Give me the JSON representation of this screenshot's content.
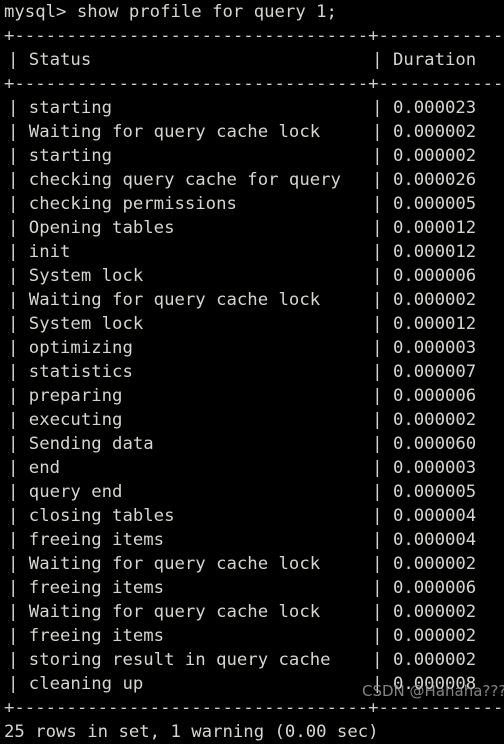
{
  "terminal": {
    "prompt_line": "mysql> show profile for query 1;",
    "separator_char": "+",
    "dash_char": "-",
    "pipe_char": "|",
    "bg_color": "#000000",
    "fg_color": "#d3d7cf",
    "columns": [
      {
        "name": "Status",
        "header": "Status",
        "width": 32,
        "align": "left"
      },
      {
        "name": "Duration",
        "header": "Duration",
        "width": 10,
        "align": "left"
      }
    ],
    "rows": [
      {
        "status": "starting",
        "duration": "0.000023"
      },
      {
        "status": "Waiting for query cache lock",
        "duration": "0.000002"
      },
      {
        "status": "starting",
        "duration": "0.000002"
      },
      {
        "status": "checking query cache for query",
        "duration": "0.000026"
      },
      {
        "status": "checking permissions",
        "duration": "0.000005"
      },
      {
        "status": "Opening tables",
        "duration": "0.000012"
      },
      {
        "status": "init",
        "duration": "0.000012"
      },
      {
        "status": "System lock",
        "duration": "0.000006"
      },
      {
        "status": "Waiting for query cache lock",
        "duration": "0.000002"
      },
      {
        "status": "System lock",
        "duration": "0.000012"
      },
      {
        "status": "optimizing",
        "duration": "0.000003"
      },
      {
        "status": "statistics",
        "duration": "0.000007"
      },
      {
        "status": "preparing",
        "duration": "0.000006"
      },
      {
        "status": "executing",
        "duration": "0.000002"
      },
      {
        "status": "Sending data",
        "duration": "0.000060"
      },
      {
        "status": "end",
        "duration": "0.000003"
      },
      {
        "status": "query end",
        "duration": "0.000005"
      },
      {
        "status": "closing tables",
        "duration": "0.000004"
      },
      {
        "status": "freeing items",
        "duration": "0.000004"
      },
      {
        "status": "Waiting for query cache lock",
        "duration": "0.000002"
      },
      {
        "status": "freeing items",
        "duration": "0.000006"
      },
      {
        "status": "Waiting for query cache lock",
        "duration": "0.000002"
      },
      {
        "status": "freeing items",
        "duration": "0.000002"
      },
      {
        "status": "storing result in query cache",
        "duration": "0.000002"
      },
      {
        "status": "cleaning up",
        "duration": "0.000008"
      }
    ],
    "footer_line": "25 rows in set, 1 warning (0.00 sec)",
    "watermark": "CSDN @Hahaha???"
  }
}
